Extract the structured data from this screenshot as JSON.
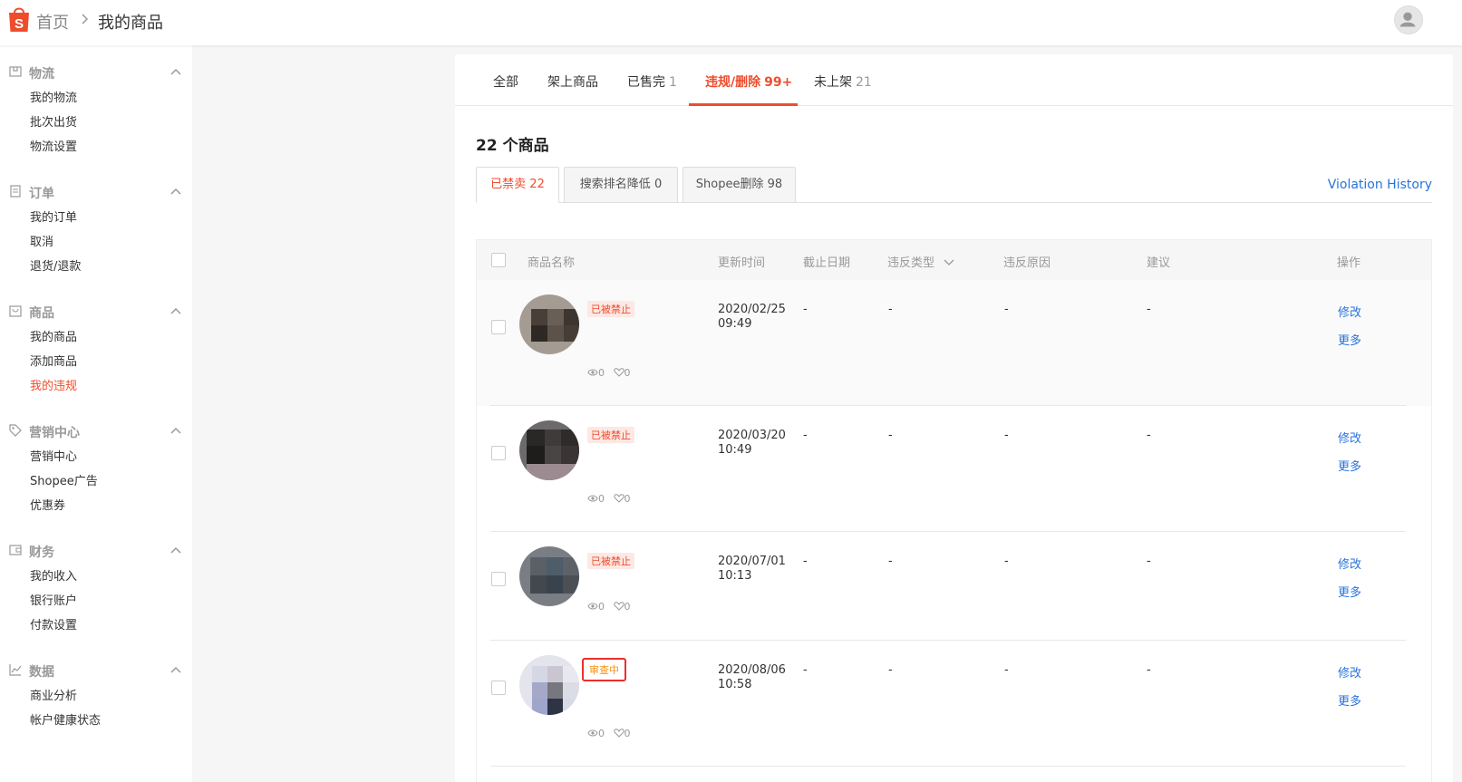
{
  "header": {
    "breadcrumb_home": "首页",
    "breadcrumb_current": "我的商品",
    "brand_color": "#ee4d2d"
  },
  "sidebar": {
    "sections": [
      {
        "title": "物流",
        "icon": "box-icon",
        "items": [
          "我的物流",
          "批次出货",
          "物流设置"
        ]
      },
      {
        "title": "订单",
        "icon": "clipboard-icon",
        "items": [
          "我的订单",
          "取消",
          "退货/退款"
        ]
      },
      {
        "title": "商品",
        "icon": "bag-icon",
        "items": [
          "我的商品",
          "添加商品",
          "我的违规"
        ],
        "active_item": "我的违规"
      },
      {
        "title": "营销中心",
        "icon": "tag-icon",
        "items": [
          "营销中心",
          "Shopee广告",
          "优惠券"
        ]
      },
      {
        "title": "财务",
        "icon": "wallet-icon",
        "items": [
          "我的收入",
          "银行账户",
          "付款设置"
        ]
      },
      {
        "title": "数据",
        "icon": "chart-icon",
        "items": [
          "商业分析",
          "帐户健康状态"
        ]
      }
    ]
  },
  "tabs": [
    {
      "label": "全部",
      "count": ""
    },
    {
      "label": "架上商品",
      "count": ""
    },
    {
      "label": "已售完",
      "count": "1"
    },
    {
      "label": "违规/删除",
      "count": "99+",
      "active": true
    },
    {
      "label": "未上架",
      "count": "21"
    }
  ],
  "product_count_title": "22 个商品",
  "subtabs": [
    {
      "label": "已禁卖",
      "count": "22",
      "active": true
    },
    {
      "label": "搜索排名降低",
      "count": "0"
    },
    {
      "label": "Shopee删除",
      "count": "98"
    }
  ],
  "violation_history_link": "Violation History",
  "table": {
    "columns": [
      "商品名称",
      "更新时间",
      "截止日期",
      "违反类型",
      "违反原因",
      "建议",
      "操作"
    ],
    "rows": [
      {
        "status": "已被禁止",
        "views": "0",
        "likes": "0",
        "date": "2020/02/25",
        "time": "09:49",
        "deadline": "-",
        "type": "-",
        "reason": "-",
        "advice": "-",
        "edit": "修改",
        "more": "更多"
      },
      {
        "status": "已被禁止",
        "views": "0",
        "likes": "0",
        "date": "2020/03/20",
        "time": "10:49",
        "deadline": "-",
        "type": "-",
        "reason": "-",
        "advice": "-",
        "edit": "修改",
        "more": "更多"
      },
      {
        "status": "已被禁止",
        "views": "0",
        "likes": "0",
        "date": "2020/07/01",
        "time": "10:13",
        "deadline": "-",
        "type": "-",
        "reason": "-",
        "advice": "-",
        "edit": "修改",
        "more": "更多"
      },
      {
        "status": "审查中",
        "views": "0",
        "likes": "0",
        "date": "2020/08/06",
        "time": "10:58",
        "deadline": "-",
        "type": "-",
        "reason": "-",
        "advice": "-",
        "edit": "修改",
        "more": "更多"
      }
    ]
  }
}
